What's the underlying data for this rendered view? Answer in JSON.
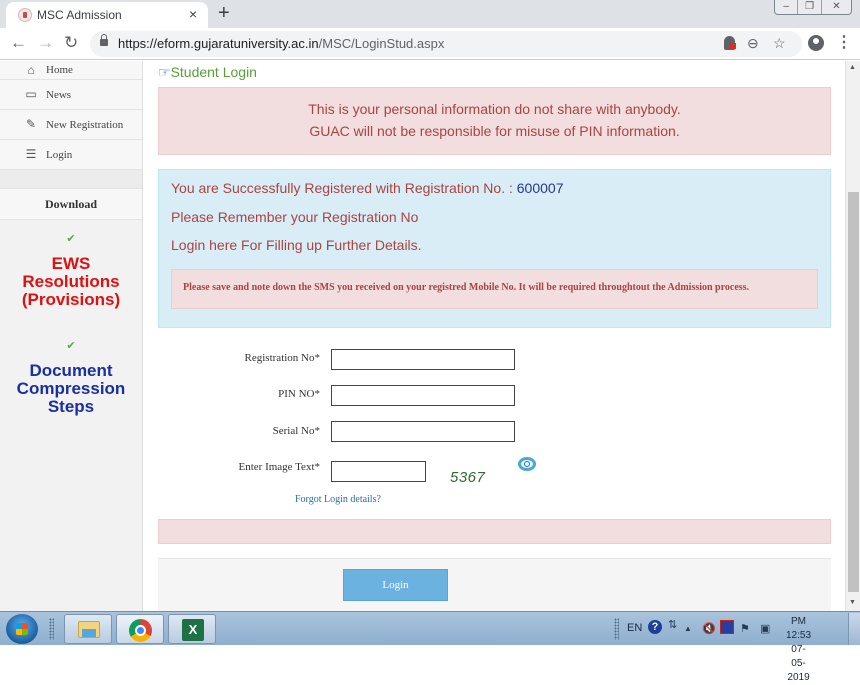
{
  "browser": {
    "tab_title": "MSC Admission",
    "tab_close": "×",
    "new_tab": "+",
    "url_host": "https://eform.gujaratuniversity.ac.in",
    "url_path": "/MSC/LoginStud.aspx",
    "window_controls": {
      "minimize": "–",
      "restore": "❐",
      "close": "✕"
    },
    "nav": {
      "back": "←",
      "forward": "→",
      "reload": "↻"
    },
    "zoom_icon": "⊖",
    "star_icon": "☆",
    "menu_icon": "⋮"
  },
  "sidebar": {
    "items": [
      {
        "label": "Home",
        "icon": "home-icon",
        "glyph": "⌂"
      },
      {
        "label": "News",
        "icon": "monitor-icon",
        "glyph": "▭"
      },
      {
        "label": "New Registration",
        "icon": "edit-icon",
        "glyph": "✎"
      },
      {
        "label": "Login",
        "icon": "list-icon",
        "glyph": "☰"
      }
    ],
    "download_heading": "Download",
    "check_glyph": "✔",
    "links": [
      {
        "label": "EWS Resolutions (Provisions)",
        "lines": [
          "EWS",
          "Resolutions",
          "(Provisions)"
        ],
        "color": "#dd1111"
      },
      {
        "label": "Document Compression Steps",
        "lines": [
          "Document",
          "Compression",
          "Steps"
        ],
        "color": "#1a2fa0"
      }
    ]
  },
  "main": {
    "heading_icon": "☞",
    "heading": "Student Login",
    "warning": {
      "line1": "This is your personal information do not share with anybody.",
      "line2": "GUAC will not be responsible for misuse of PIN information."
    },
    "success": {
      "line1_prefix": "You are Successfully Registered with Registration No. : ",
      "registration_no": "600007",
      "line2": "Please Remember your Registration No",
      "line3": "Login here For Filling up Further Details.",
      "sms_note": "Please save and note down the SMS you received on your registred Mobile No. It will be required throughtout the Admission process."
    },
    "form": {
      "registration_label": "Registration No*",
      "registration_value": "",
      "pin_label": "PIN NO*",
      "pin_value": "",
      "serial_label": "Serial No*",
      "serial_value": "",
      "captcha_label": "Enter Image Text*",
      "captcha_value": "",
      "captcha_text": "5367",
      "forgot_link": "Forgot Login details?"
    },
    "login_button": "Login"
  },
  "colors": {
    "heading": "#5a9e3a",
    "alert_danger_bg": "#f2dede",
    "alert_danger_text": "#a94442",
    "alert_info_bg": "#d9edf7",
    "registration_no": "#23398f",
    "login_button": "#6cb2e0"
  },
  "taskbar": {
    "apps": [
      {
        "name": "File Explorer",
        "icon": "folder-icon"
      },
      {
        "name": "Google Chrome",
        "icon": "chrome-icon",
        "active": true
      },
      {
        "name": "Microsoft Excel",
        "icon": "excel-icon",
        "glyph": "X"
      }
    ],
    "language": "EN",
    "help_glyph": "?",
    "up_arrow": "▲",
    "time": "PM 12:53",
    "date": "07-05-2019"
  }
}
